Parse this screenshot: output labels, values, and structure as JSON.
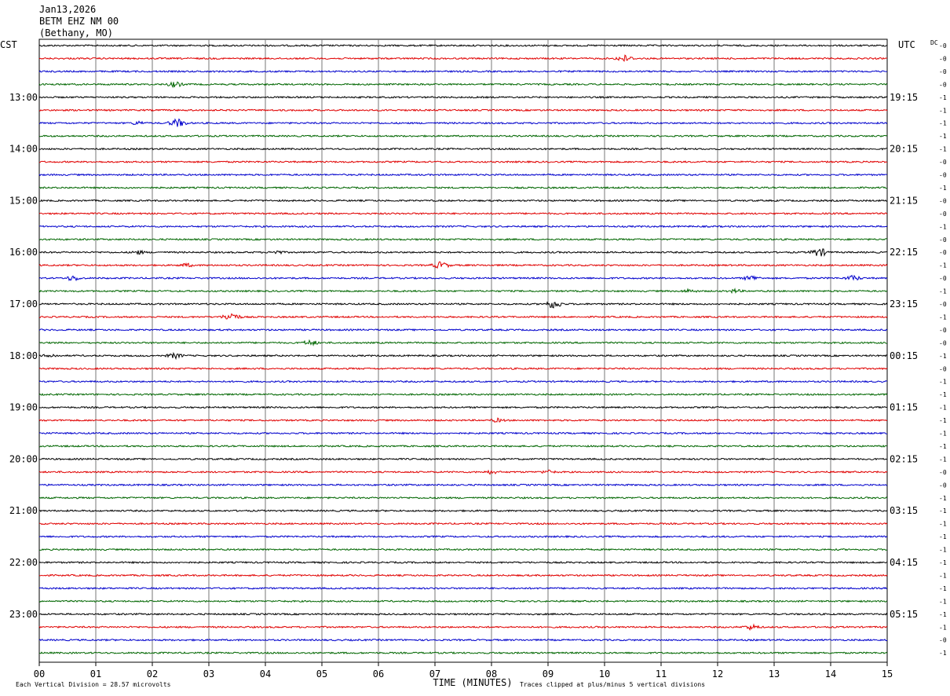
{
  "header": {
    "date": "Jan13,2026",
    "station": "BETM EHZ NM 00",
    "location": "(Bethany, MO)"
  },
  "chart_data": {
    "type": "line",
    "title": "Jan13,2026",
    "xlabel": "TIME (MINUTES)",
    "left_tz": "CST",
    "right_tz": "UTC",
    "dc_label": "DC",
    "x_ticks": [
      "00",
      "01",
      "02",
      "03",
      "04",
      "05",
      "06",
      "07",
      "08",
      "09",
      "10",
      "11",
      "12",
      "13",
      "14",
      "15"
    ],
    "xlim": [
      0,
      15
    ],
    "trace_colors": [
      "#000000",
      "#e00000",
      "#0000cc",
      "#006600"
    ],
    "left_hour_labels": [
      {
        "trace": 4,
        "label": "13:00"
      },
      {
        "trace": 8,
        "label": "14:00"
      },
      {
        "trace": 12,
        "label": "15:00"
      },
      {
        "trace": 16,
        "label": "16:00"
      },
      {
        "trace": 20,
        "label": "17:00"
      },
      {
        "trace": 24,
        "label": "18:00"
      },
      {
        "trace": 28,
        "label": "19:00"
      },
      {
        "trace": 32,
        "label": "20:00"
      },
      {
        "trace": 36,
        "label": "21:00"
      },
      {
        "trace": 40,
        "label": "22:00"
      },
      {
        "trace": 44,
        "label": "23:00"
      }
    ],
    "right_hour_labels": [
      {
        "trace": 4,
        "label": "19:15"
      },
      {
        "trace": 8,
        "label": "20:15"
      },
      {
        "trace": 12,
        "label": "21:15"
      },
      {
        "trace": 16,
        "label": "22:15"
      },
      {
        "trace": 20,
        "label": "23:15"
      },
      {
        "trace": 24,
        "label": "00:15"
      },
      {
        "trace": 28,
        "label": "01:15"
      },
      {
        "trace": 32,
        "label": "02:15"
      },
      {
        "trace": 36,
        "label": "03:15"
      },
      {
        "trace": 40,
        "label": "04:15"
      },
      {
        "trace": 44,
        "label": "05:15"
      }
    ],
    "dc_offsets": [
      "-0",
      "-0",
      "-0",
      "-0",
      "-1",
      "-1",
      "-1",
      "-1",
      "-1",
      "-0",
      "-0",
      "-1",
      "-0",
      "-0",
      "-1",
      "-0",
      "-0",
      "-1",
      "-0",
      "-1",
      "-0",
      "-1",
      "-0",
      "-0",
      "-1",
      "-0",
      "-1",
      "-1",
      "-1",
      "-1",
      "-1",
      "-1",
      "-1",
      "-0",
      "-0",
      "-1",
      "-1",
      "-1",
      "-1",
      "-1",
      "-1",
      "-1",
      "-1",
      "-1",
      "-1",
      "-1",
      "-0",
      "-1"
    ],
    "events": [
      {
        "trace": 1,
        "minute": 10.35,
        "amp": 5
      },
      {
        "trace": 3,
        "minute": 2.4,
        "amp": 4
      },
      {
        "trace": 6,
        "minute": 2.45,
        "amp": 6
      },
      {
        "trace": 6,
        "minute": 1.75,
        "amp": 3
      },
      {
        "trace": 16,
        "minute": 13.8,
        "amp": 6
      },
      {
        "trace": 16,
        "minute": 4.2,
        "amp": 3
      },
      {
        "trace": 16,
        "minute": 1.75,
        "amp": 3
      },
      {
        "trace": 17,
        "minute": 7.1,
        "amp": 5
      },
      {
        "trace": 17,
        "minute": 2.6,
        "amp": 3
      },
      {
        "trace": 18,
        "minute": 12.6,
        "amp": 4
      },
      {
        "trace": 18,
        "minute": 14.4,
        "amp": 4
      },
      {
        "trace": 18,
        "minute": 0.6,
        "amp": 4
      },
      {
        "trace": 19,
        "minute": 11.5,
        "amp": 3
      },
      {
        "trace": 19,
        "minute": 12.3,
        "amp": 3
      },
      {
        "trace": 20,
        "minute": 9.1,
        "amp": 6
      },
      {
        "trace": 21,
        "minute": 3.4,
        "amp": 6
      },
      {
        "trace": 23,
        "minute": 4.8,
        "amp": 4
      },
      {
        "trace": 24,
        "minute": 2.4,
        "amp": 4
      },
      {
        "trace": 24,
        "minute": 0.2,
        "amp": 3
      },
      {
        "trace": 29,
        "minute": 8.1,
        "amp": 3
      },
      {
        "trace": 33,
        "minute": 9.0,
        "amp": 3
      },
      {
        "trace": 33,
        "minute": 8.0,
        "amp": 3
      },
      {
        "trace": 45,
        "minute": 12.6,
        "amp": 4
      }
    ]
  },
  "footer": {
    "scale_text": "Each Vertical Division =   28.57 microvolts",
    "clip_text": "Traces clipped at plus/minus 5 vertical divisions"
  }
}
